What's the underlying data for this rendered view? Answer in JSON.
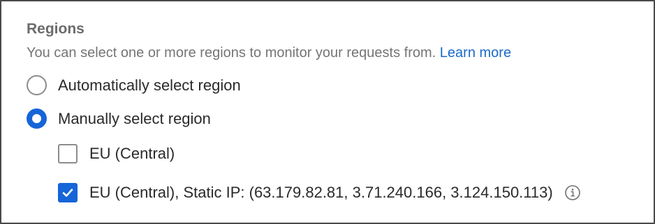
{
  "regions": {
    "title": "Regions",
    "description": "You can select one or more regions to monitor your requests from.",
    "learn_more_label": "Learn more",
    "options": {
      "automatic": {
        "label": "Automatically select region",
        "selected": false
      },
      "manual": {
        "label": "Manually select region",
        "selected": true
      }
    },
    "region_list": [
      {
        "label": "EU (Central)",
        "checked": false
      },
      {
        "label": "EU (Central), Static IP: (63.179.82.81, 3.71.240.166, 3.124.150.113)",
        "checked": true,
        "icon": "info-icon"
      }
    ]
  },
  "colors": {
    "accent": "#1565d8",
    "link": "#1a6bc8",
    "title_text": "#6b6b6b",
    "body_text": "#2a2a2a"
  }
}
